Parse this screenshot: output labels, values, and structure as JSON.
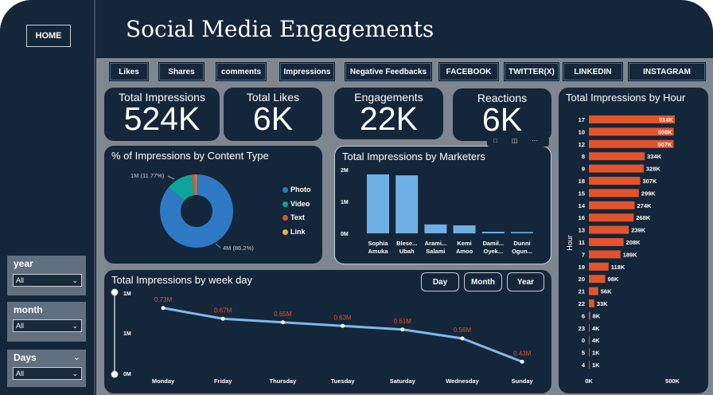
{
  "app": {
    "title": "Social Media Engagements",
    "home_label": "HOME"
  },
  "toolbar": {
    "buttons": [
      "Likes",
      "Shares",
      "comments",
      "Impressions",
      "Negative Feedbacks",
      "FACEBOOK",
      "TWITTER(X)",
      "LINKEDIN",
      "INSTAGRAM"
    ]
  },
  "kpis": {
    "impressions": {
      "label": "Total Impressions",
      "value": "524K"
    },
    "likes": {
      "label": "Total Likes",
      "value": "6K"
    },
    "engagements": {
      "label": "Engagements",
      "value": "22K"
    },
    "reactions": {
      "label": "Reactions",
      "value": "6K"
    }
  },
  "filters": {
    "year": {
      "label": "year",
      "value": "All"
    },
    "month": {
      "label": "month",
      "value": "All"
    },
    "days": {
      "label": "Days",
      "value": "All"
    }
  },
  "time_buttons": [
    "Day",
    "Month",
    "Year"
  ],
  "colors": {
    "photo": "#2f79c4",
    "video": "#0fa39a",
    "text": "#e4532b",
    "link": "#f0b429",
    "bar_orange": "#e4532b",
    "bar_blue": "#6fb0e4",
    "line": "#7eb9ec",
    "point_label": "#e4532b"
  },
  "chart_data": [
    {
      "type": "pie",
      "title": "% of Impressions by Content Type",
      "labels": [
        "Photo",
        "Video",
        "Text",
        "Link"
      ],
      "values": [
        86.2,
        11.77,
        1.7,
        0.33
      ],
      "data_labels": [
        "4M (86.2%)",
        "1M (11.77%)"
      ]
    },
    {
      "type": "bar",
      "title": "Total Impressions by Marketers",
      "categories": [
        [
          "Sophia",
          "Amuka"
        ],
        [
          "Blese...",
          "Ubah"
        ],
        [
          "Arami...",
          "Salami"
        ],
        [
          "Kemi",
          "Amoo"
        ],
        [
          "Damil...",
          "Oyek..."
        ],
        [
          "Dunni",
          "Ogun..."
        ]
      ],
      "values": [
        1.85,
        1.82,
        0.28,
        0.25,
        0.05,
        0.04
      ],
      "yticks": [
        "0M",
        "1M",
        "2M"
      ],
      "ylim": [
        0,
        2
      ]
    },
    {
      "type": "bar",
      "orientation": "horizontal",
      "title": "Total Impressions by Hour",
      "ylabel": "Hour",
      "categories": [
        "17",
        "10",
        "12",
        "8",
        "9",
        "18",
        "15",
        "14",
        "16",
        "13",
        "11",
        "7",
        "19",
        "20",
        "21",
        "22",
        "6",
        "23",
        "0",
        "5",
        "4"
      ],
      "values": [
        514,
        508,
        507,
        334,
        328,
        307,
        299,
        274,
        268,
        239,
        208,
        189,
        118,
        98,
        56,
        33,
        8,
        4,
        4,
        1,
        1
      ],
      "value_labels": [
        "514K",
        "508K",
        "507K",
        "334K",
        "328K",
        "307K",
        "299K",
        "274K",
        "268K",
        "239K",
        "208K",
        "189K",
        "118K",
        "98K",
        "56K",
        "33K",
        "8K",
        "4K",
        "4K",
        "1K",
        "1K"
      ],
      "xticks": [
        "0K",
        "500K"
      ],
      "xlim": [
        0,
        600
      ]
    },
    {
      "type": "line",
      "title": "Total Impressions by week day",
      "categories": [
        "Monday",
        "Friday",
        "Thursday",
        "Tuesday",
        "Saturday",
        "Wednesday",
        "Sunday"
      ],
      "values": [
        0.73,
        0.67,
        0.65,
        0.63,
        0.61,
        0.56,
        0.43
      ],
      "value_labels": [
        "0.73M",
        "0.67M",
        "0.65M",
        "0.63M",
        "0.61M",
        "0.56M",
        "0.43M"
      ],
      "yticks": [
        "0M",
        "1M"
      ],
      "ylim": [
        0.4,
        0.8
      ],
      "slider_ticks": [
        "1M",
        "0M"
      ]
    }
  ]
}
